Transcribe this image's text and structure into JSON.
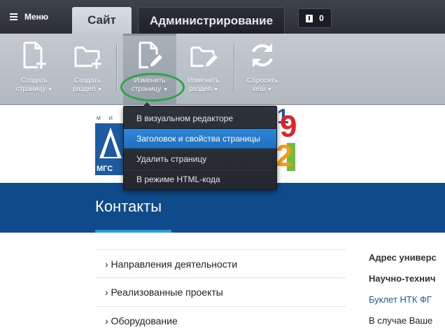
{
  "topbar": {
    "menu_label": "Меню",
    "tabs": [
      {
        "label": "Сайт",
        "active": true
      },
      {
        "label": "Администрирование",
        "active": false
      }
    ],
    "notifications_count": "0"
  },
  "toolbar": {
    "buttons": [
      {
        "line1": "Создать",
        "line2": "страницу",
        "icon": "create-page-icon"
      },
      {
        "line1": "Создать",
        "line2": "раздел",
        "icon": "create-folder-icon"
      },
      {
        "line1": "Изменить",
        "line2": "страницу",
        "icon": "edit-page-icon",
        "active": true
      },
      {
        "line1": "Изменить",
        "line2": "раздел",
        "icon": "edit-folder-icon"
      },
      {
        "line1": "Сбросить",
        "line2": "кеш",
        "icon": "refresh-icon"
      }
    ]
  },
  "dropdown": {
    "items": [
      {
        "label": "В визуальном редакторе",
        "active": false
      },
      {
        "label": "Заголовок и свойства страницы",
        "active": true
      },
      {
        "label": "Удалить страницу",
        "active": false
      },
      {
        "label": "В режиме HTML-кода",
        "active": false
      }
    ]
  },
  "logo": {
    "abbr": "МГС",
    "numbers": [
      "1",
      "9",
      "2"
    ]
  },
  "page": {
    "title": "Контакты",
    "side_nav": [
      "› Направления деятельности",
      "› Реализованные проекты",
      "› Оборудование"
    ],
    "right_col": [
      "Адрес универс",
      "Научно-технич",
      "Буклет НТК ФГ",
      "В случае Ваше"
    ]
  },
  "colors": {
    "brand_blue": "#0f4a8a",
    "accent_blue": "#2e9be0",
    "highlight_green": "#2fa24a"
  }
}
